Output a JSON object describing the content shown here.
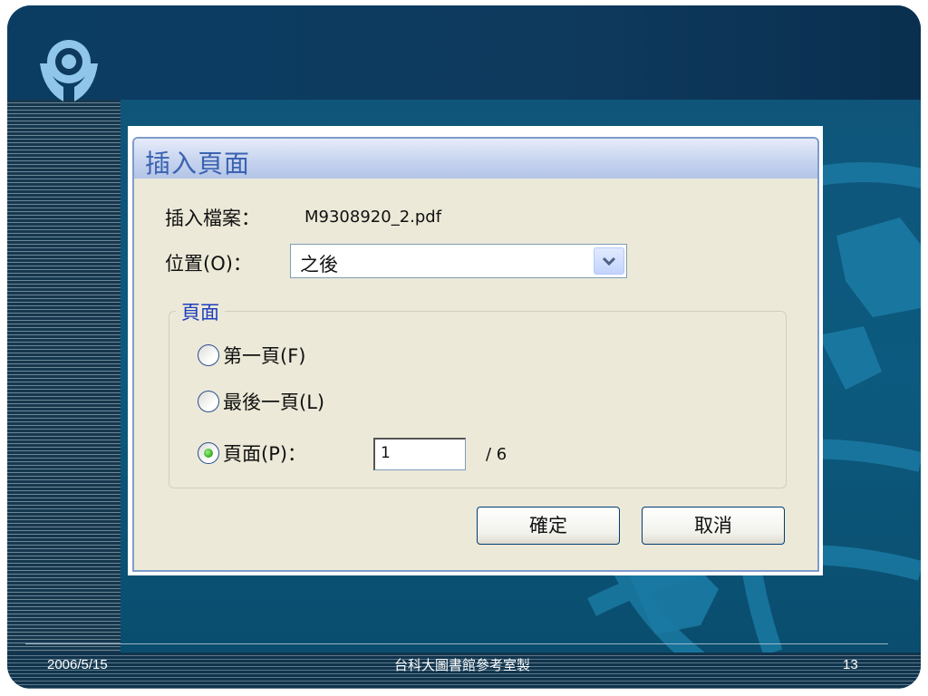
{
  "slide": {
    "footer_date": "2006/5/15",
    "footer_center": "台科大圖書館參考室製",
    "footer_page": "13"
  },
  "dialog": {
    "title": "插入頁面",
    "file_label": "插入檔案：",
    "file_value": "M9308920_2.pdf",
    "position_label": "位置(O)：",
    "position_value": "之後",
    "group_title": "頁面",
    "radio_first_label": "第一頁(F)",
    "radio_last_label": "最後一頁(L)",
    "radio_page_label": "頁面(P)：",
    "page_input_value": "1",
    "page_total": "/ 6",
    "ok_label": "確定",
    "cancel_label": "取消",
    "selected_option": "頁面(P)"
  },
  "colors": {
    "slide_bg": "#0d4b6e",
    "title_text": "#3b63b0",
    "group_legend": "#1f3fbf",
    "radio_selected": "#3bb52a"
  },
  "icons": {
    "logo": "library-logo-icon",
    "dropdown": "chevron-down-icon"
  }
}
